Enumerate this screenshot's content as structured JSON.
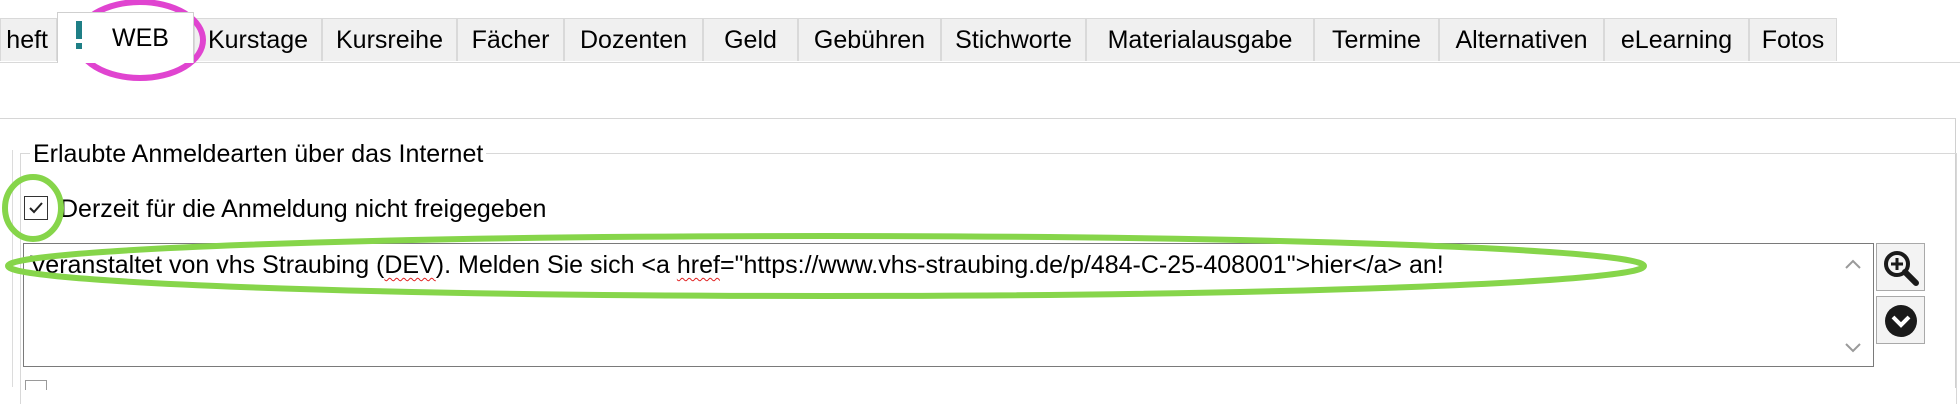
{
  "tabs": [
    {
      "label": "heft"
    },
    {
      "label": "WEB",
      "active": true,
      "flag_icon": "exclamation-icon"
    },
    {
      "label": "Kurstage"
    },
    {
      "label": "Kursreihe"
    },
    {
      "label": "Fächer"
    },
    {
      "label": "Dozenten"
    },
    {
      "label": "Geld"
    },
    {
      "label": "Gebühren"
    },
    {
      "label": "Stichworte"
    },
    {
      "label": "Materialausgabe"
    },
    {
      "label": "Termine"
    },
    {
      "label": "Alternativen"
    },
    {
      "label": "eLearning"
    },
    {
      "label": "Fotos"
    }
  ],
  "group": {
    "legend": "Erlaubte Anmeldearten über das Internet",
    "checkbox_label": "Derzeit für die Anmeldung nicht freigegeben",
    "checkbox_checked": true,
    "text_part1": "Veranstaltet von vhs Straubing (",
    "text_dev": "DEV",
    "text_part2": "). Melden Sie sich <a ",
    "text_href": "href",
    "text_part3": "=\"https://www.vhs-straubing.de/p/484-C-25-408001\">hier</a> an!"
  },
  "side_buttons": {
    "zoom_icon": "zoom-in-icon",
    "dropdown_icon": "chevron-down-circle-icon"
  },
  "colors": {
    "annotation_magenta": "#e044d0",
    "annotation_green": "#86d54a",
    "tab_flag": "#1f7f86"
  }
}
